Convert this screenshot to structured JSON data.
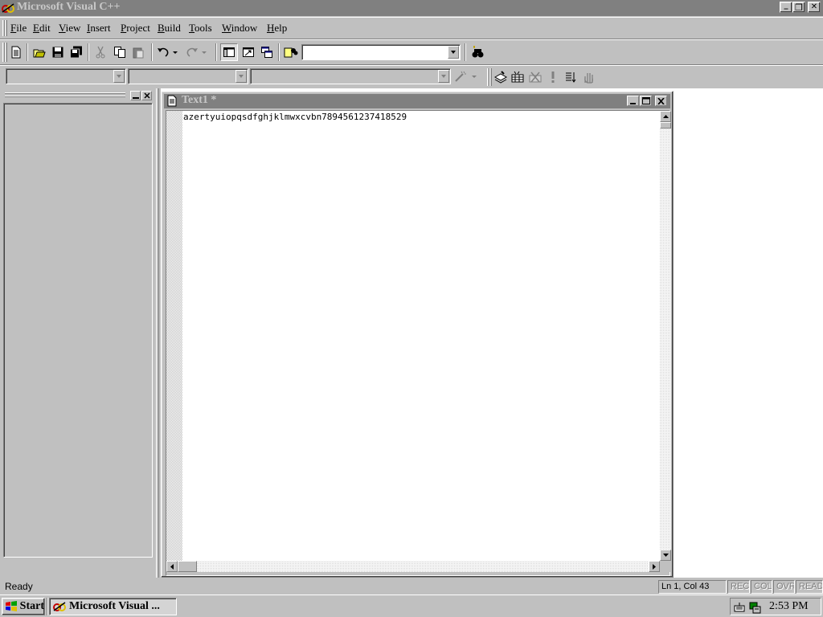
{
  "app": {
    "title": "Microsoft Visual C++"
  },
  "caption_buttons": {
    "minimize": "_",
    "restore": "❐",
    "close": "✕"
  },
  "menu": {
    "items": [
      {
        "label": "File",
        "accel": "F",
        "rest": "ile"
      },
      {
        "label": "Edit",
        "accel": "E",
        "rest": "dit"
      },
      {
        "label": "View",
        "accel": "V",
        "rest": "iew"
      },
      {
        "label": "Insert",
        "accel": "I",
        "rest": "nsert"
      },
      {
        "label": "Project",
        "accel": "P",
        "rest": "roject"
      },
      {
        "label": "Build",
        "accel": "B",
        "rest": "uild"
      },
      {
        "label": "Tools",
        "accel": "T",
        "rest": "ools"
      },
      {
        "label": "Window",
        "accel": "W",
        "rest": "indow"
      },
      {
        "label": "Help",
        "accel": "H",
        "rest": "elp"
      }
    ]
  },
  "toolbar": {
    "find_combo_value": ""
  },
  "wizardbar": {
    "class_combo_value": "",
    "filter_combo_value": "",
    "members_combo_value": ""
  },
  "child_window": {
    "title": "Text1 *"
  },
  "editor": {
    "line1": "azertyuiopqsdfghjklmwxcvbn7894561237418529"
  },
  "statusbar": {
    "message": "Ready",
    "position": "Ln 1, Col 43",
    "rec": "REC",
    "col": "COL",
    "ovr": "OVR",
    "read": "READ"
  },
  "taskbar": {
    "start_label": "Start",
    "task_label": "Microsoft Visual ...",
    "clock": "2:53 PM"
  },
  "icons": {
    "app": "visual-cpp-icon",
    "document": "text-document-icon"
  }
}
